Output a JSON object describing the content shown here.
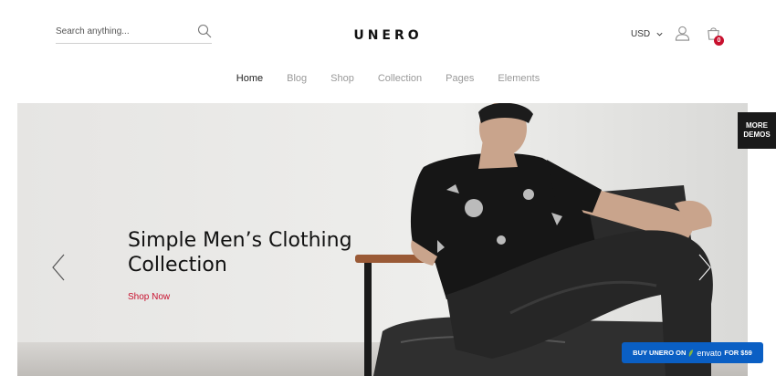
{
  "header": {
    "search": {
      "placeholder": "Search anything..."
    },
    "logo": "UNERO",
    "currency": "USD",
    "cart_count": "0",
    "icons": [
      "search-icon",
      "user-icon",
      "cart-icon",
      "chevron-down-icon"
    ]
  },
  "nav": {
    "items": [
      {
        "label": "Home",
        "active": true
      },
      {
        "label": "Blog"
      },
      {
        "label": "Shop"
      },
      {
        "label": "Collection"
      },
      {
        "label": "Pages"
      },
      {
        "label": "Elements"
      }
    ]
  },
  "hero": {
    "headline_line1": "Simple Men’s Clothing",
    "headline_line2": "Collection",
    "cta": "Shop Now",
    "accent_color": "#c8102e"
  },
  "side": {
    "more_demos_line1": "MORE",
    "more_demos_line2": "DEMOS"
  },
  "buy": {
    "prefix": "BUY UNERO ON",
    "brand": "envato",
    "suffix": "FOR $59",
    "color": "#0a5fc4"
  }
}
